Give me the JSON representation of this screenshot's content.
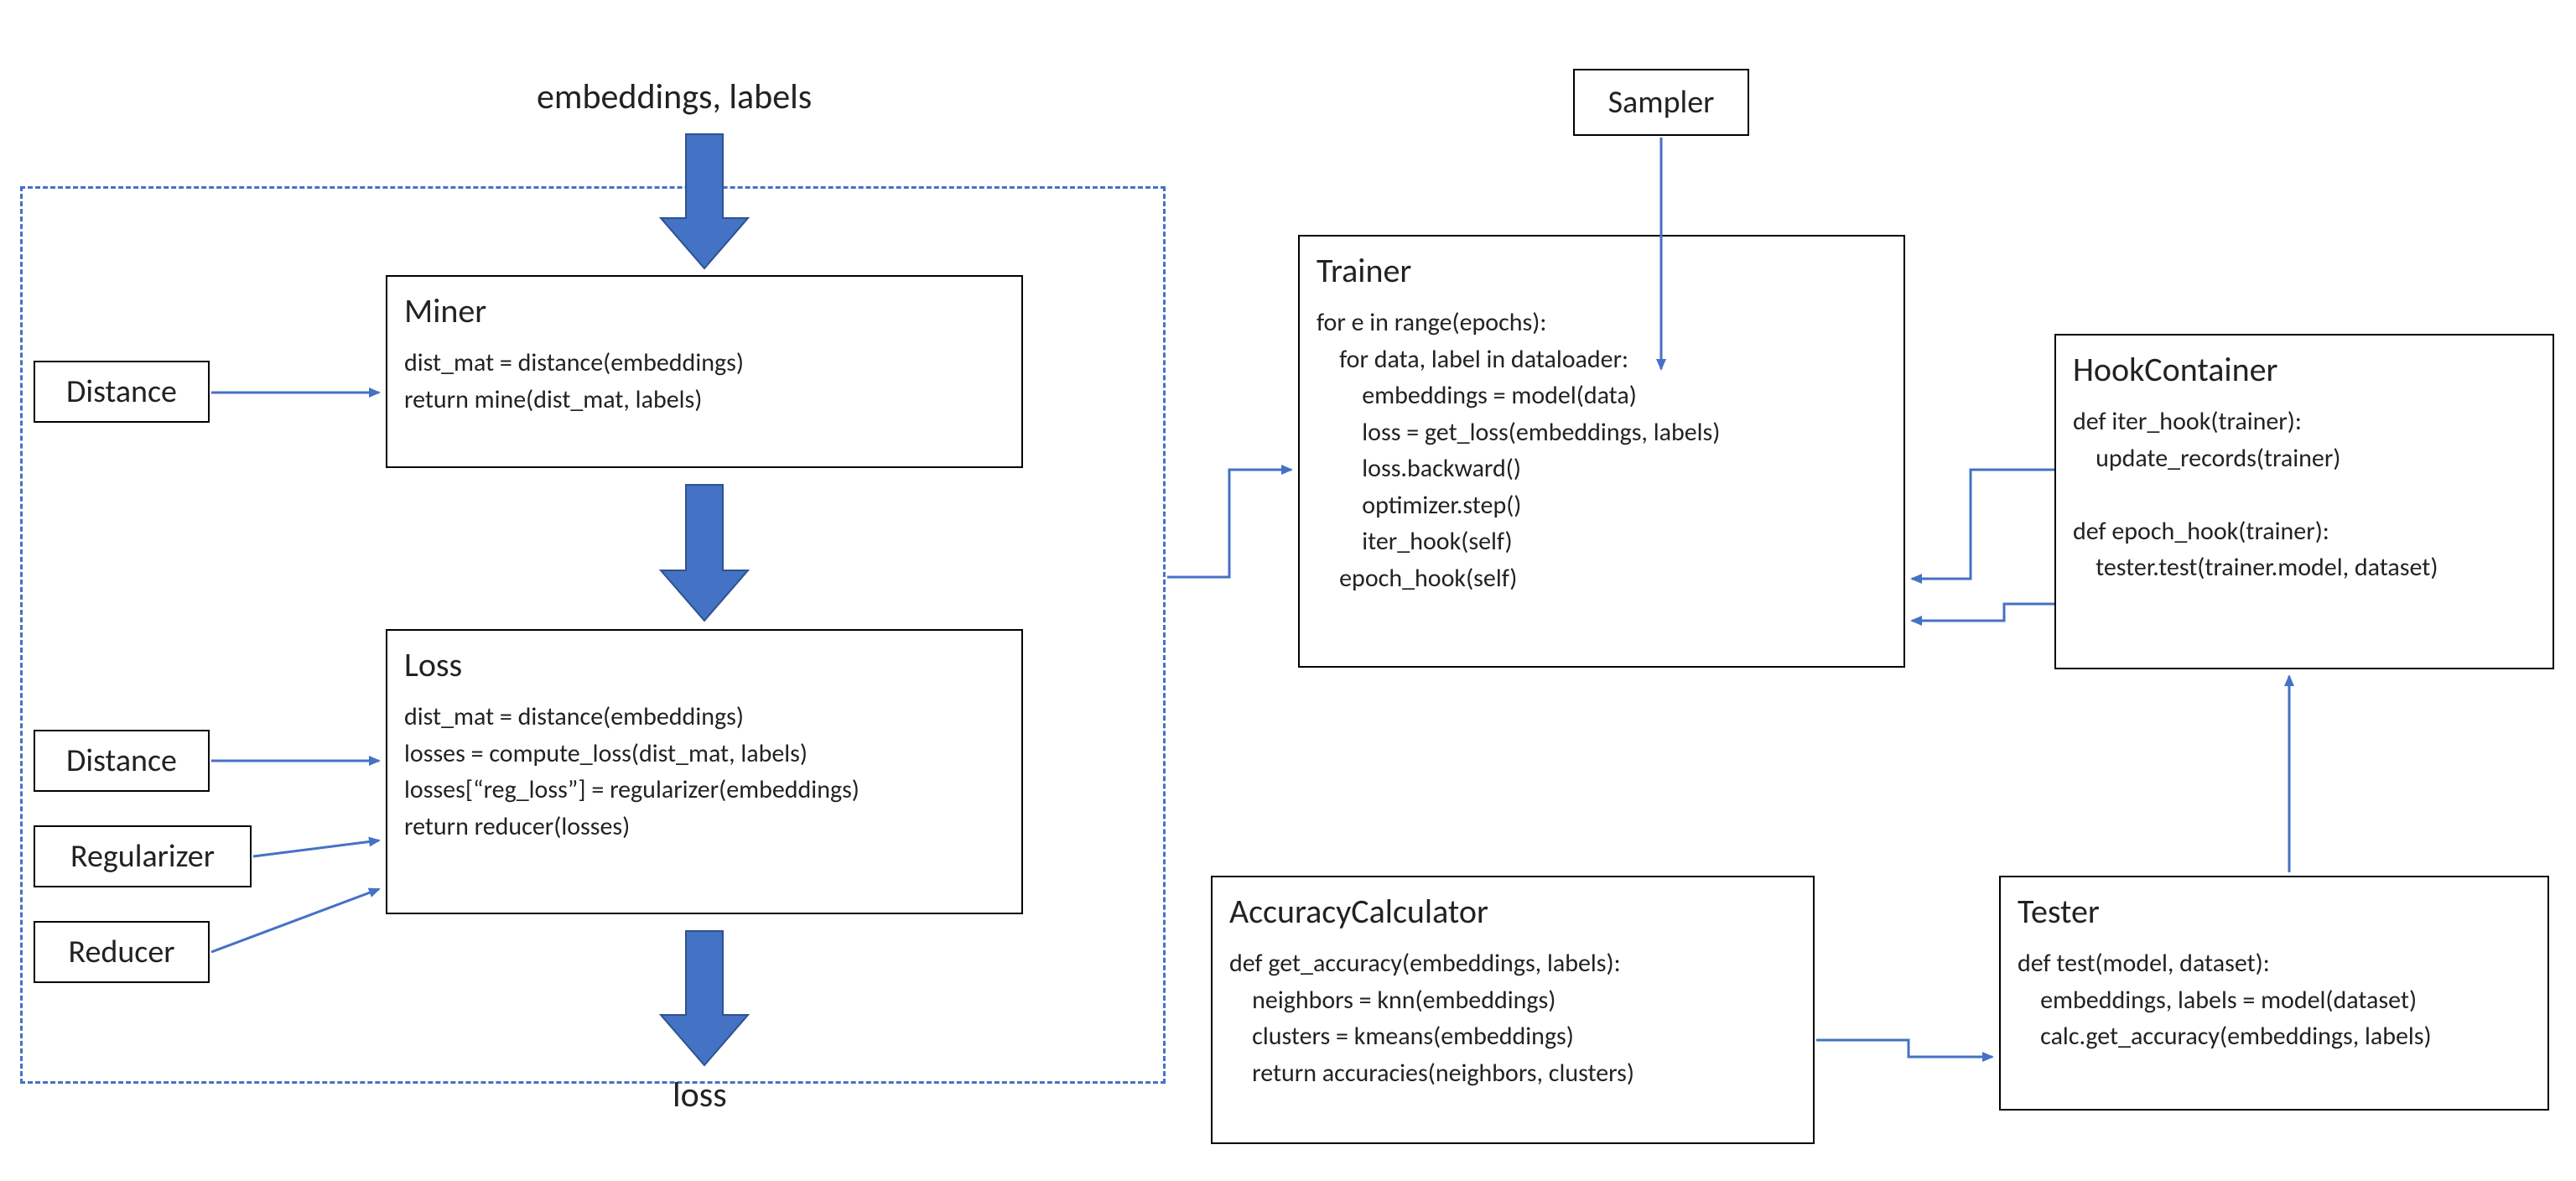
{
  "labels": {
    "top_input": "embeddings, labels",
    "loss_output": "loss"
  },
  "small": {
    "distance1": "Distance",
    "distance2": "Distance",
    "regularizer": "Regularizer",
    "reducer": "Reducer",
    "sampler": "Sampler"
  },
  "miner": {
    "title": "Miner",
    "body": "dist_mat = distance(embeddings)\nreturn mine(dist_mat, labels)"
  },
  "loss": {
    "title": "Loss",
    "body": "dist_mat = distance(embeddings)\nlosses = compute_loss(dist_mat, labels)\nlosses[“reg_loss”] = regularizer(embeddings)\nreturn reducer(losses)"
  },
  "trainer": {
    "title": "Trainer",
    "body": "for e in range(epochs):\n    for data, label in dataloader:\n        embeddings = model(data)\n        loss = get_loss(embeddings, labels)\n        loss.backward()\n        optimizer.step()\n        iter_hook(self)\n    epoch_hook(self)"
  },
  "hook": {
    "title": "HookContainer",
    "body": "def iter_hook(trainer):\n    update_records(trainer)\n\ndef epoch_hook(trainer):\n    tester.test(trainer.model, dataset)"
  },
  "accuracy": {
    "title": "AccuracyCalculator",
    "body": "def get_accuracy(embeddings, labels):\n    neighbors = knn(embeddings)\n    clusters = kmeans(embeddings)\n    return accuracies(neighbors, clusters)"
  },
  "tester": {
    "title": "Tester",
    "body": "def test(model, dataset):\n    embeddings, labels = model(dataset)\n    calc.get_accuracy(embeddings, labels)"
  },
  "colors": {
    "thick_arrow": "#4472C4",
    "thin_arrow": "#4472C4",
    "dashed": "#4472C4"
  }
}
